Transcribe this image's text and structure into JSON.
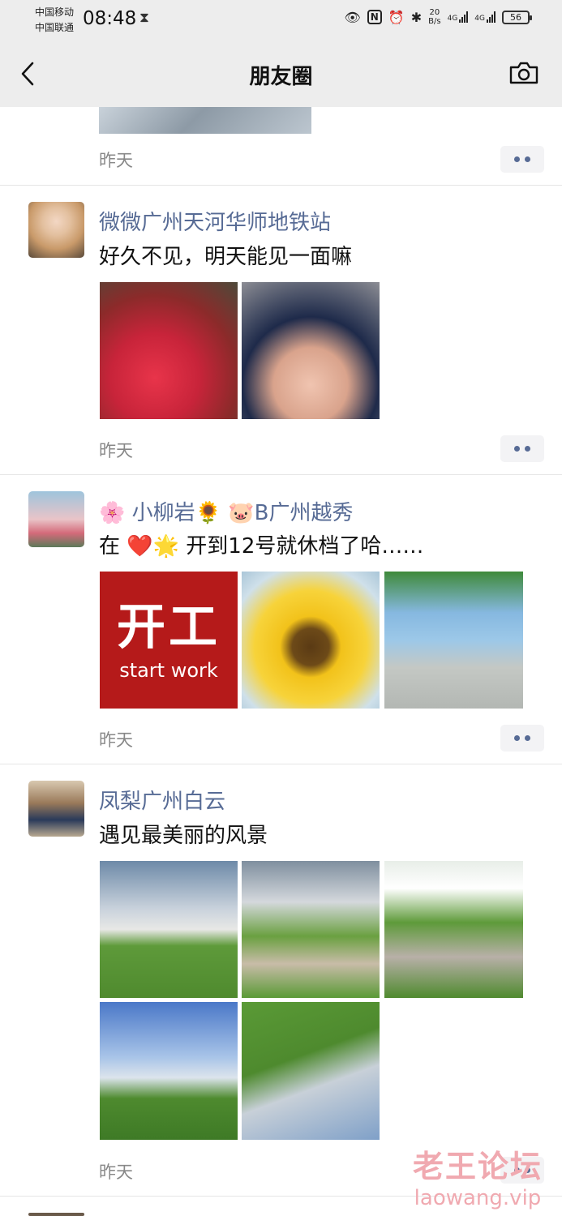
{
  "status_bar": {
    "carrier1": "中国移动",
    "carrier2": "中国联通",
    "time": "08:48",
    "speed_value": "20",
    "speed_unit": "B/s",
    "net1": "4G",
    "net2": "4G",
    "battery": "56"
  },
  "header": {
    "title": "朋友圈"
  },
  "posts": [
    {
      "time": "昨天"
    },
    {
      "name": "微微广州天河华师地铁站",
      "text": "好久不见，明天能见一面嘛",
      "time": "昨天"
    },
    {
      "name": "🌸 小柳岩🌻 🐷B广州越秀",
      "text": "在 ❤️🌟  开到12号就休档了哈……",
      "startwork_big": "开工",
      "startwork_small": "start work",
      "time": "昨天"
    },
    {
      "name": "凤梨广州白云",
      "text": "遇见最美丽的风景",
      "time": "昨天"
    }
  ],
  "watermark": {
    "cn": "老王论坛",
    "url": "laowang.vip"
  },
  "icons": {
    "back": "chevron-left-icon",
    "camera": "camera-icon",
    "more": "more-dots-icon"
  },
  "colors": {
    "name_link": "#576b95",
    "timestamp": "#888888",
    "bar_background": "#ededed"
  }
}
